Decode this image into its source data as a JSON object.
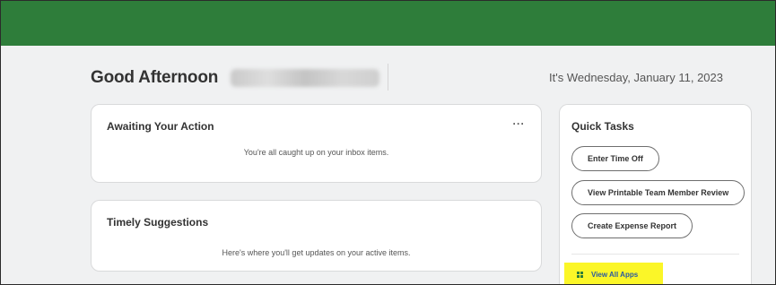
{
  "header": {
    "greeting": "Good Afternoon",
    "date": "It's Wednesday, January 11, 2023",
    "banner_color": "#2e7d3a"
  },
  "awaiting": {
    "title": "Awaiting Your Action",
    "more": "···",
    "message": "You're all caught up on your inbox items."
  },
  "timely": {
    "title": "Timely Suggestions",
    "message": "Here's where you'll get updates on your active items."
  },
  "quick_tasks": {
    "title": "Quick Tasks",
    "tasks": [
      {
        "label": "Enter Time Off"
      },
      {
        "label": "View Printable Team Member Review"
      },
      {
        "label": "Create Expense Report"
      }
    ],
    "view_all": "View All Apps",
    "view_all_icon": "grid-icon",
    "highlight_color": "#fbf628"
  }
}
